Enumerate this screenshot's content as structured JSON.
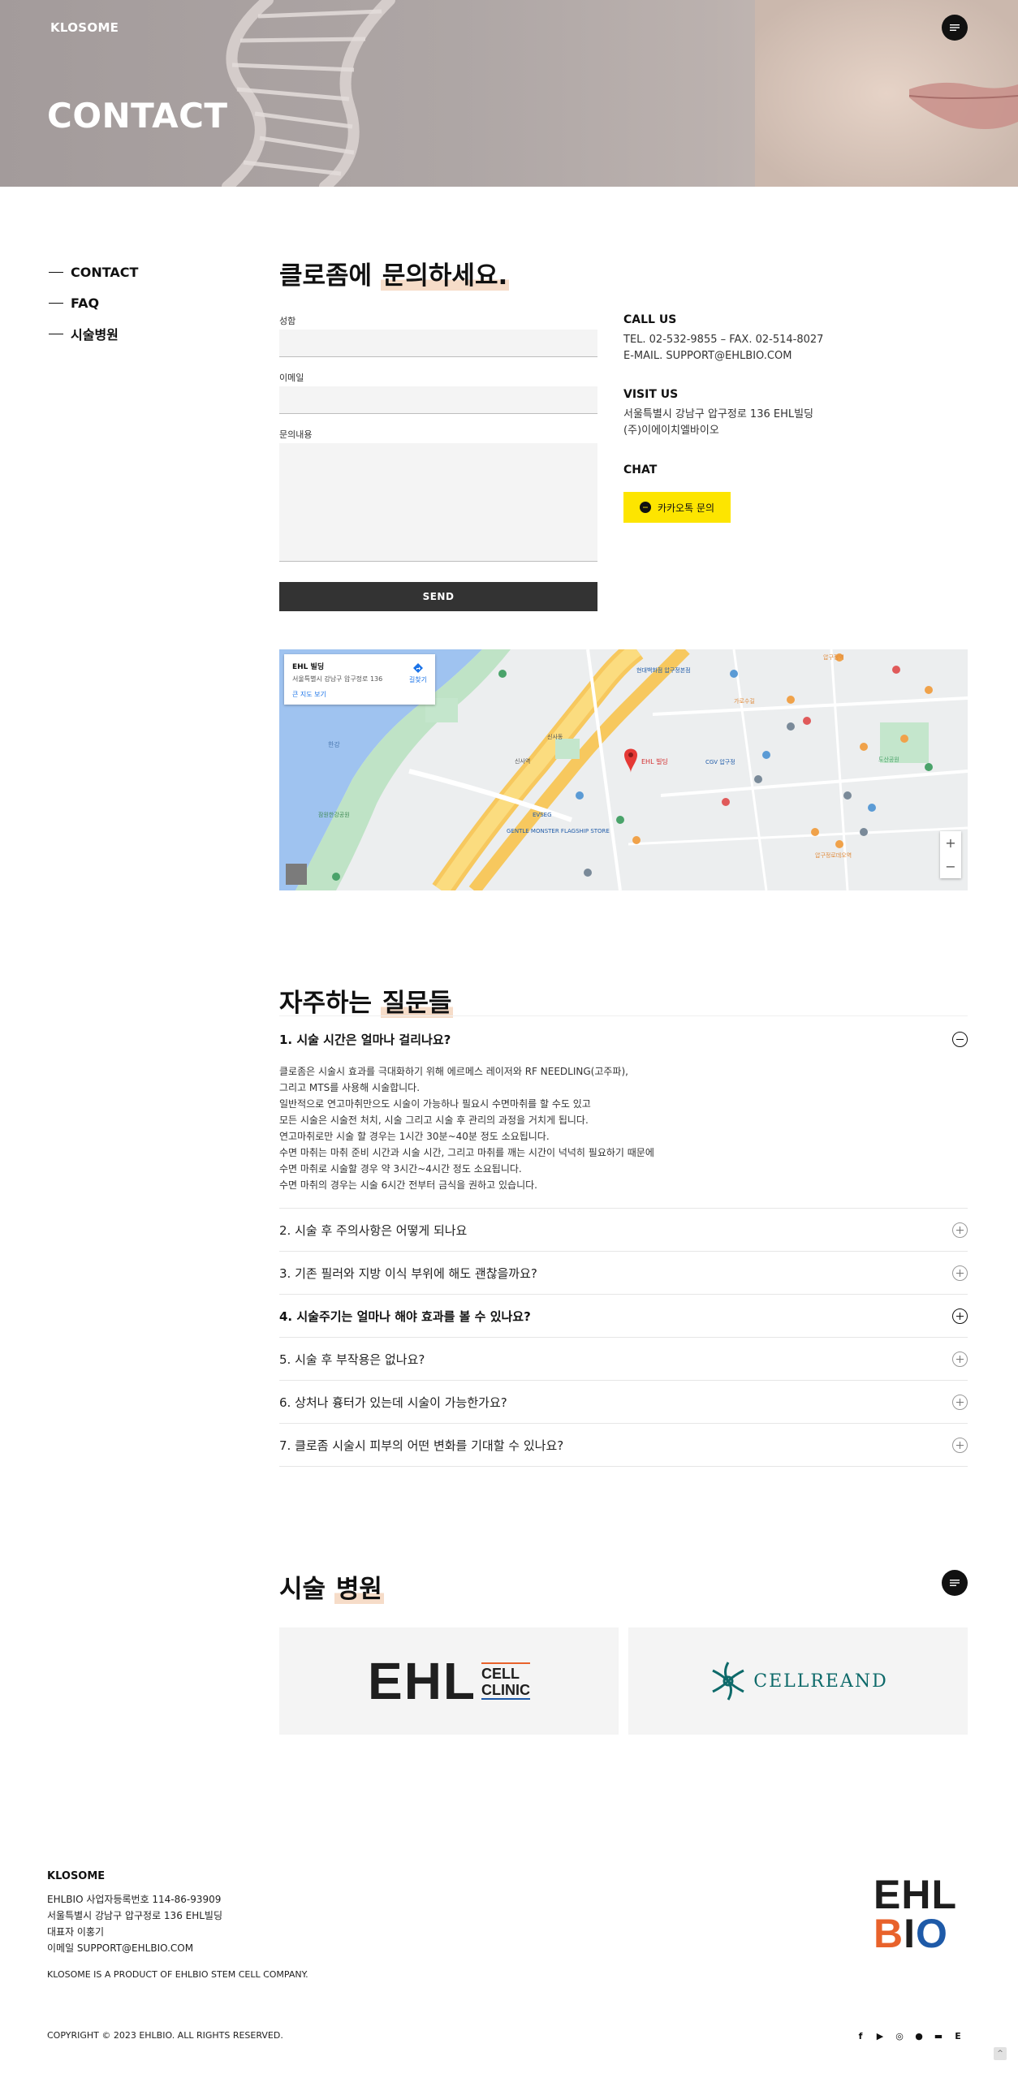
{
  "header": {
    "logo": "KLOSOME",
    "hero_title": "CONTACT"
  },
  "side_nav": {
    "items": [
      {
        "label": "CONTACT"
      },
      {
        "label": "FAQ"
      },
      {
        "label": "시술병원"
      }
    ]
  },
  "contact": {
    "title_plain": "클로좀에 ",
    "title_highlight": "문의하세요.",
    "form": {
      "name_label": "성함",
      "email_label": "이메일",
      "message_label": "문의내용",
      "send_label": "SEND"
    },
    "call_us": {
      "heading": "CALL US",
      "lines": [
        "TEL. 02-532-9855 – FAX. 02-514-8027",
        "E-MAIL. SUPPORT@EHLBIO.COM"
      ]
    },
    "visit_us": {
      "heading": "VISIT US",
      "lines": [
        "서울특별시 강남구 압구정로 136 EHL빌딩",
        "(주)이에이치엘바이오"
      ]
    },
    "chat": {
      "heading": "CHAT",
      "kakao_label": "카카오톡 문의"
    }
  },
  "map": {
    "place_name": "EHL 빌딩",
    "place_address": "서울특별시 강남구 압구정로 136",
    "directions_label": "길찾기",
    "more_label": "큰 지도 보기",
    "pin_label": "EHL 빌딩",
    "zoom_in": "+",
    "zoom_out": "−",
    "labels": [
      "현대백화점 압구정본점",
      "압구정역",
      "신사역",
      "신사동",
      "CGV 압구정",
      "가로수길",
      "도산공원",
      "GENTLE MONSTER FLAGSHIP STORE",
      "EVSEG",
      "잠원한강공원",
      "압구정로데오역",
      "한강"
    ]
  },
  "faq": {
    "title_plain": "자주하는 ",
    "title_highlight": "질문들",
    "open_question": "1. 시술 시간은 얼마나 걸리나요?",
    "open_answer": [
      "클로좀은 시술시 효과를 극대화하기 위해 에르메스 레이저와 RF NEEDLING(고주파),",
      "그리고 MTS를 사용해 시술합니다.",
      "일반적으로 연고마취만으도 시술이 가능하나 필요시 수면마취를 할 수도 있고",
      "모든 시술은 시술전 처치, 시술 그리고 시술 후 관리의 과정을 거치게 됩니다.",
      "연고마취로만 시술 할 경우는 1시간 30분~40분 정도 소요됩니다.",
      "수면 마취는 마취 준비 시간과 시술 시간, 그리고 마취를 깨는 시간이 넉넉히 필요하기 때문에",
      "수면 마취로 시술할 경우 약 3시간~4시간 정도 소요됩니다.",
      "수면 마취의 경우는 시술 6시간 전부터 금식을 권하고 있습니다."
    ],
    "questions": [
      {
        "text": "2. 시술 후 주의사항은 어떻게 되나요"
      },
      {
        "text": "3. 기존 필러와 지방 이식 부위에 해도 괜찮을까요?"
      },
      {
        "text": "4. 시술주기는 얼마나 해야 효과를 볼 수 있나요?"
      },
      {
        "text": "5. 시술 후 부작용은 없나요?"
      },
      {
        "text": "6. 상처나 흉터가 있는데 시술이 가능한가요?"
      },
      {
        "text": "7. 클로좀 시술시 피부의 어떤 변화를 기대할 수 있나요?"
      }
    ]
  },
  "hospitals": {
    "title_plain": "시술 ",
    "title_highlight": "병원",
    "ehl_big": "EHL",
    "ehl_small_1": "CELL",
    "ehl_small_2": "CLINIC",
    "cellreand_word": "CELLREAND"
  },
  "footer": {
    "title": "KLOSOME",
    "lines": [
      "EHLBIO 사업자등록번호 114-86-93909",
      "서울특별시 강남구 압구정로 136 EHL빌딩",
      "대표자 이홍기",
      "이메일 SUPPORT@EHLBIO.COM"
    ],
    "product_line": "KLOSOME IS A PRODUCT OF EHLBIO STEM CELL COMPANY.",
    "copyright": "COPYRIGHT © 2023 EHLBIO. ALL RIGHTS RESERVED.",
    "logo_row1": "EHL",
    "logo_row2_b": "B",
    "logo_row2_i": "I",
    "logo_row2_o": "O",
    "socials": [
      "f",
      "▶",
      "◎",
      "●",
      "▬",
      "E"
    ]
  },
  "colors": {
    "highlight": "#f6dcc8",
    "kakao": "#fde500",
    "send_button": "#333333",
    "ehl_orange": "#e8622b",
    "ehl_blue": "#1e5aa8",
    "cellreand_teal": "#0e6a6a"
  }
}
